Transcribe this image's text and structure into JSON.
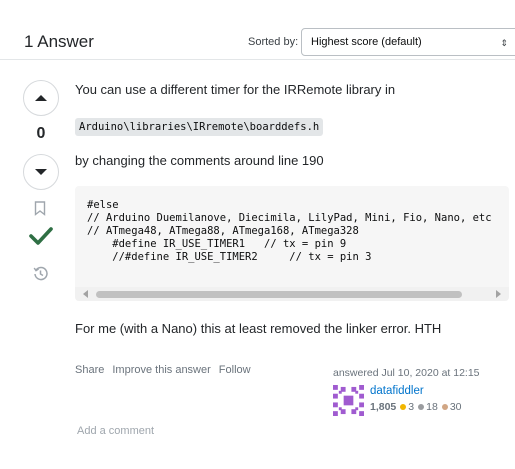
{
  "header": {
    "title": "1 Answer",
    "sort_label": "Sorted by:",
    "sort_value": "Highest score (default)"
  },
  "vote": {
    "count": "0"
  },
  "answer": {
    "paragraph1": "You can use a different timer for the IRRemote library in",
    "inline_code": "Arduino\\libraries\\IRremote\\boarddefs.h",
    "paragraph2": "by changing the comments around line 190",
    "code_block": "#else\n// Arduino Duemilanove, Diecimila, LilyPad, Mini, Fio, Nano, etc\n// ATmega48, ATmega88, ATmega168, ATmega328\n    #define IR_USE_TIMER1   // tx = pin 9\n    //#define IR_USE_TIMER2     // tx = pin 3",
    "paragraph3": "For me (with a Nano) this at least removed the linker error. HTH"
  },
  "post_menu": {
    "share": "Share",
    "improve": "Improve this answer",
    "follow": "Follow"
  },
  "user_card": {
    "answered": "answered Jul 10, 2020 at 12:15",
    "name": "datafiddler",
    "reputation": "1,805",
    "gold": "3",
    "silver": "18",
    "bronze": "30",
    "gold_color": "#f1b600",
    "silver_color": "#9a9c9f",
    "bronze_color": "#d1a684"
  },
  "comments": {
    "add_label": "Add a comment"
  },
  "icons": {
    "up": "caret-up-icon",
    "down": "caret-down-icon",
    "bookmark": "bookmark-icon",
    "accepted": "checkmark-icon",
    "history": "history-icon"
  },
  "colors": {
    "accepted_green": "#2f6f44",
    "link_blue": "#0074cc"
  }
}
